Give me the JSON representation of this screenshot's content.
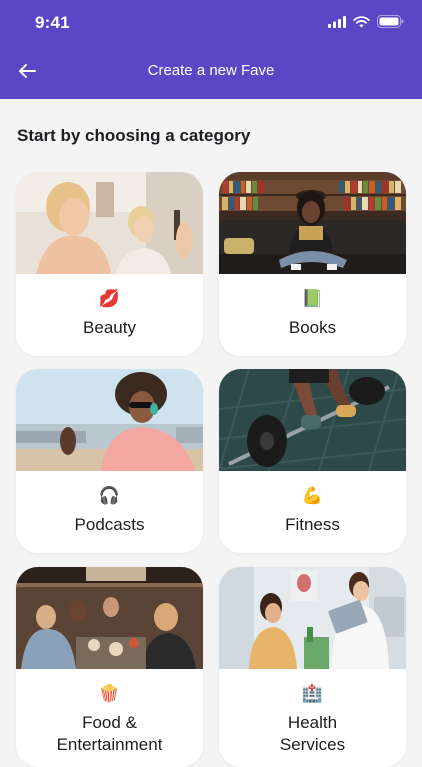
{
  "status_bar": {
    "time": "9:41"
  },
  "nav": {
    "title": "Create a new Fave"
  },
  "main": {
    "heading": "Start by choosing a category",
    "categories": [
      {
        "label": "Beauty",
        "emoji": "💋"
      },
      {
        "label": "Books",
        "emoji": "📗"
      },
      {
        "label": "Podcasts",
        "emoji": "🎧"
      },
      {
        "label": "Fitness",
        "emoji": "💪"
      },
      {
        "label": "Food &",
        "label2": "Entertainment",
        "emoji": "🍿"
      },
      {
        "label": "Health",
        "label2": "Services",
        "emoji": "🏥"
      }
    ]
  },
  "colors": {
    "header": "#5b46c6",
    "background": "#f4f4f5",
    "card": "#ffffff"
  }
}
